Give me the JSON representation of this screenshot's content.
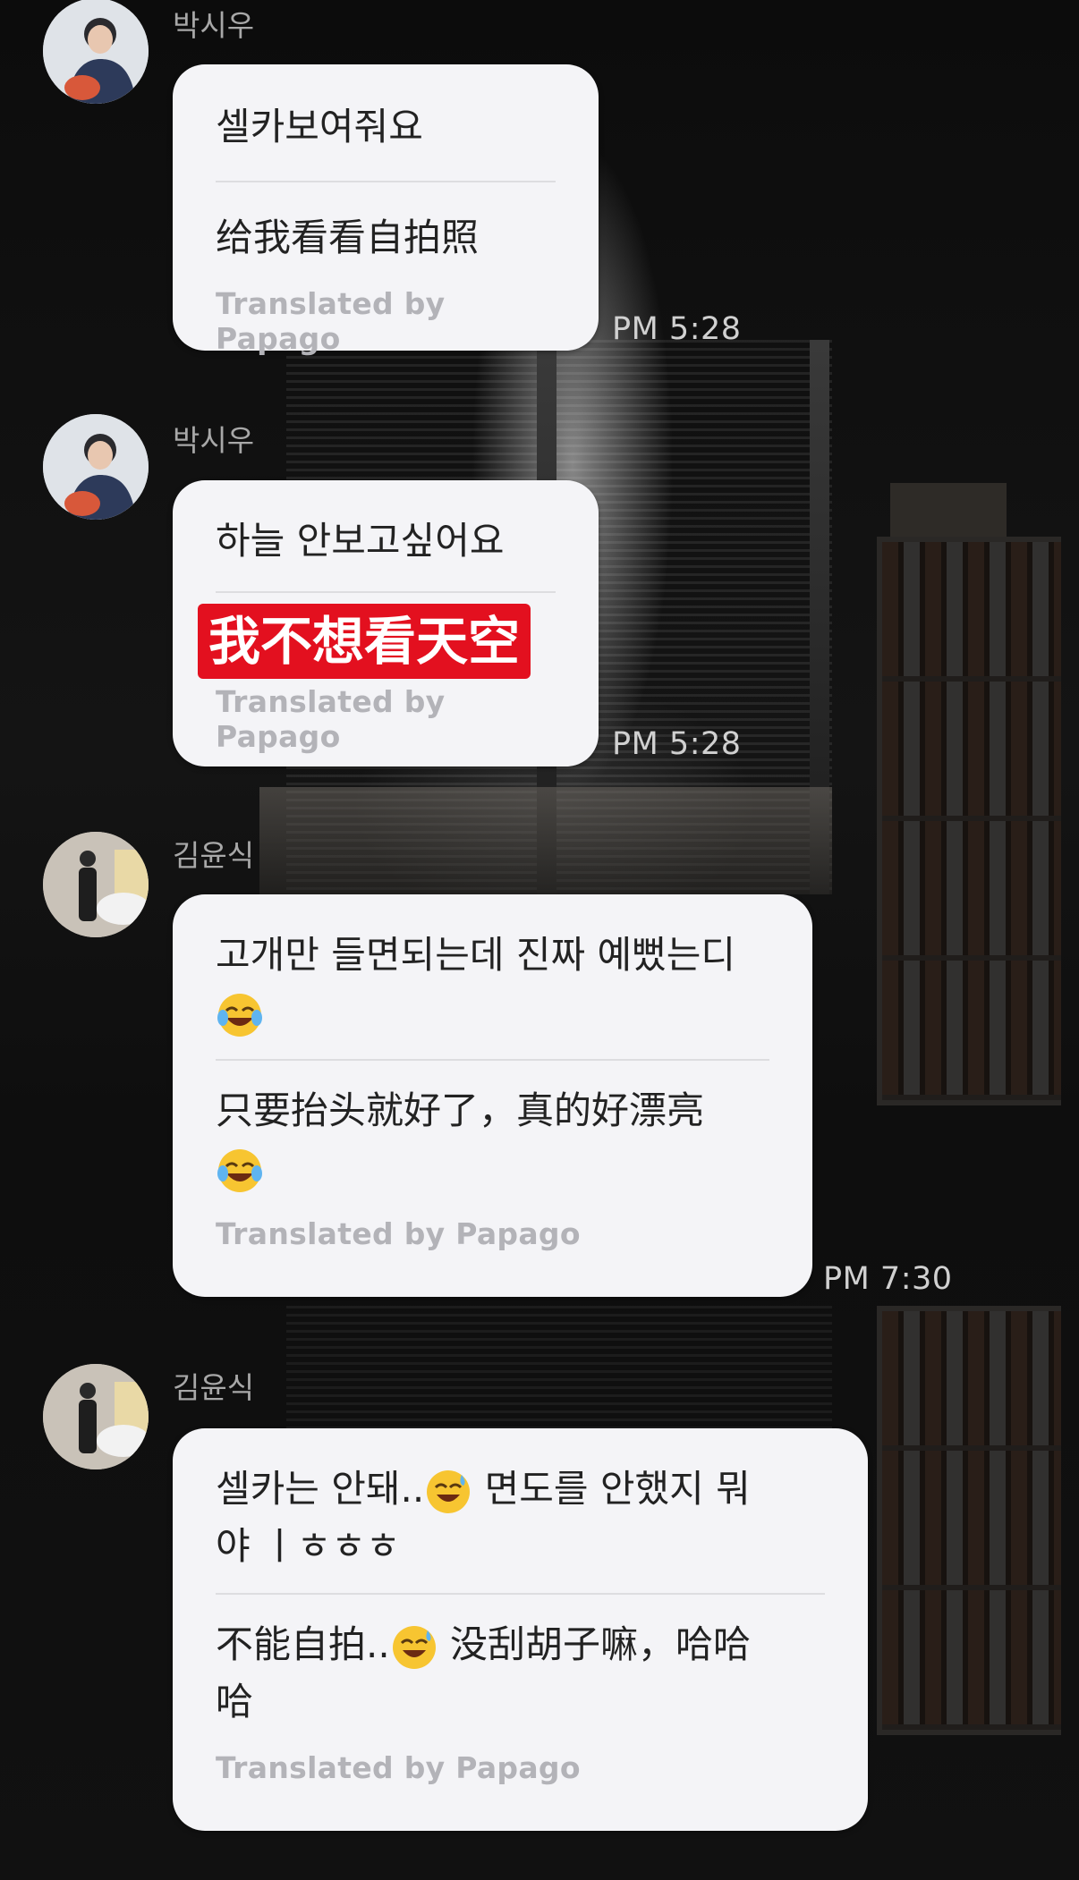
{
  "messages": [
    {
      "sender": "박시우",
      "original": "셀카보여줘요",
      "translation": "给我看看自拍照",
      "translated_by": "Translated by Papago",
      "time": "PM 5:28"
    },
    {
      "sender": "박시우",
      "original": "하늘 안보고싶어요",
      "translation": "我不想看天空",
      "translated_by": "Translated by Papago",
      "time": "PM 5:28"
    },
    {
      "sender": "김윤식",
      "original_line1": "고개만 들면되는데 진짜 예뻤는디",
      "original_emoji": "face-with-tears-of-joy",
      "translation_line1": "只要抬头就好了，真的好漂亮",
      "translation_emoji": "face-with-tears-of-joy",
      "translated_by": "Translated by Papago",
      "time": "PM 7:30"
    },
    {
      "sender": "김윤식",
      "original_part1": "셀카는 안돼..",
      "original_emoji": "grinning-face-with-sweat",
      "original_part2": " 면도를 안했지 뭐",
      "original_line2": "야 ㅣㅎㅎㅎ",
      "translation_part1": "不能自拍..",
      "translation_emoji": "grinning-face-with-sweat",
      "translation_part2": " 没刮胡子嘛，哈哈",
      "translation_line2": "哈",
      "translated_by": "Translated by Papago"
    }
  ],
  "colors": {
    "bubble": "#f4f4f7",
    "highlight": "#e3101f",
    "sender": "#a8a8a8",
    "time": "#d0d0d0"
  }
}
